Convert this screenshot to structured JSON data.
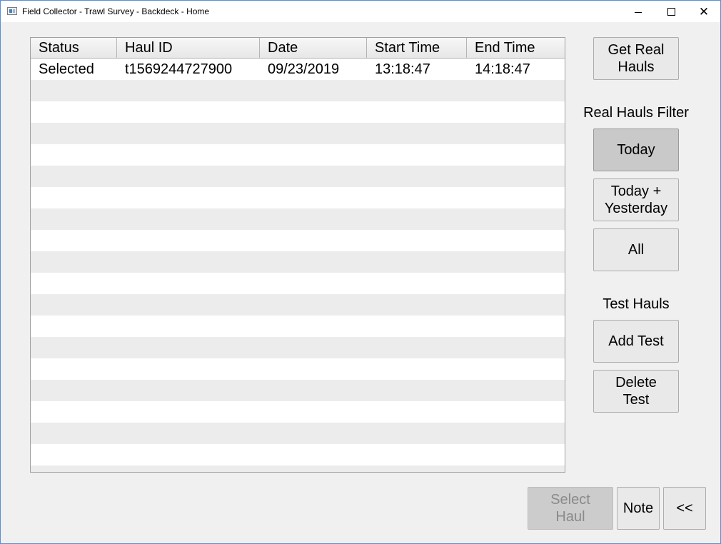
{
  "window": {
    "title": "Field Collector - Trawl Survey - Backdeck - Home",
    "controls": {
      "minimize": "minimize",
      "maximize": "maximize",
      "close": "✕"
    }
  },
  "table": {
    "columns": [
      "Status",
      "Haul ID",
      "Date",
      "Start Time",
      "End Time"
    ],
    "rows": [
      [
        "Selected",
        "t1569244727900",
        "09/23/2019",
        "13:18:47",
        "14:18:47"
      ]
    ]
  },
  "side_panel": {
    "get_real_hauls": "Get Real\nHauls",
    "filter_label": "Real Hauls Filter",
    "filter_today": "Today",
    "filter_today_yesterday": "Today +\nYesterday",
    "filter_all": "All",
    "active_filter": "Today",
    "test_label": "Test Hauls",
    "add_test": "Add Test",
    "delete_test": "Delete\nTest"
  },
  "footer": {
    "select_haul": "Select\nHaul",
    "note": "Note",
    "back": "<<"
  },
  "colors": {
    "window_border": "#5b8fd1",
    "checked_button": "#c9c9c9",
    "disabled_text": "#8a8a8a"
  }
}
